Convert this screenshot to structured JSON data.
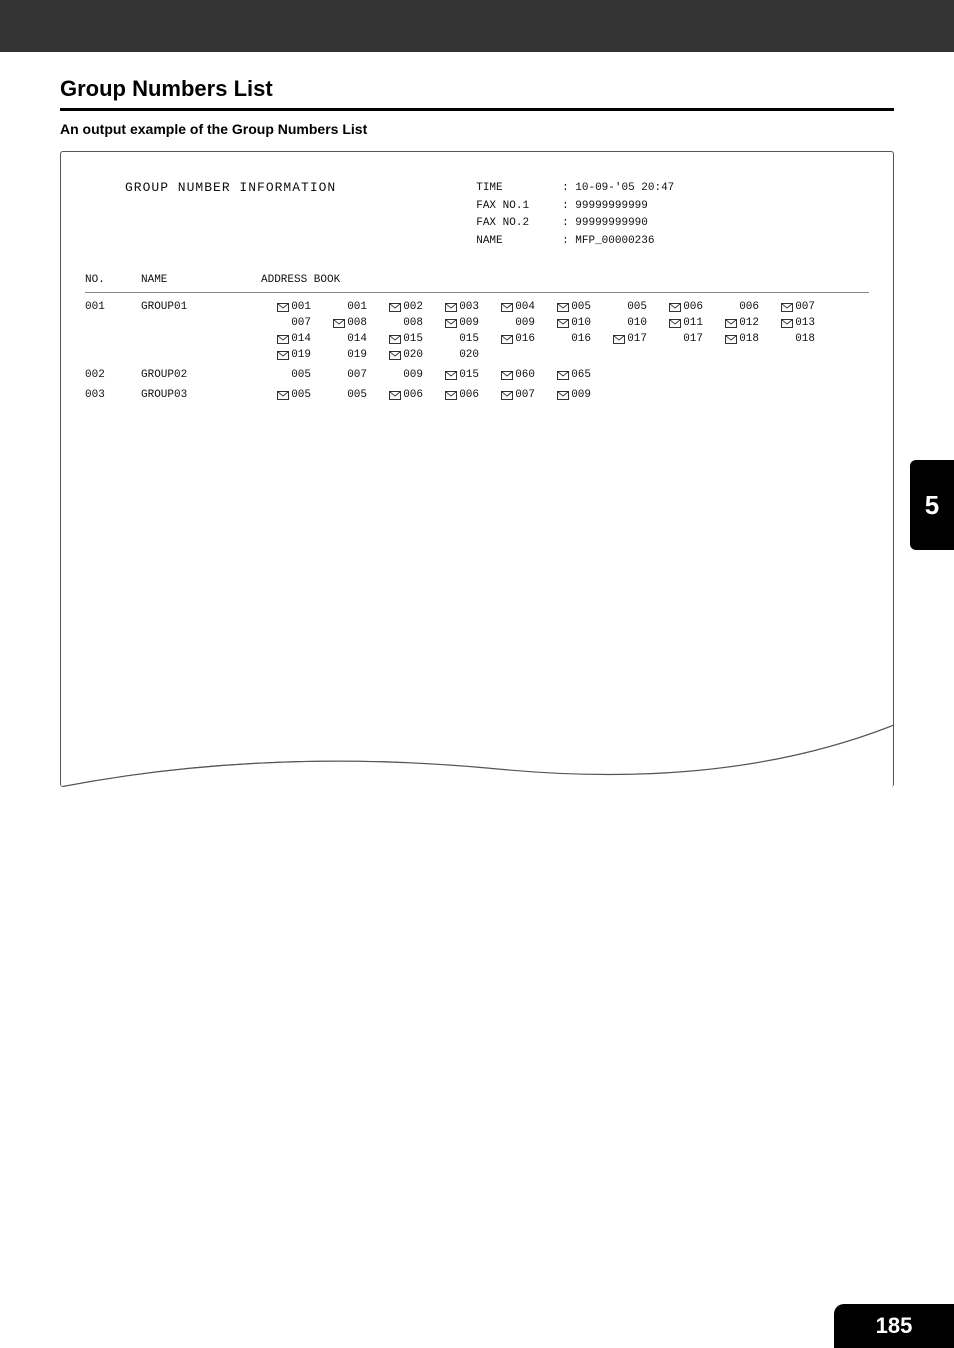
{
  "page": {
    "title": "Group Numbers List",
    "subtitle": "An output example of the Group Numbers List",
    "report_title": "GROUP NUMBER INFORMATION",
    "meta": {
      "time_label": "TIME",
      "time_value": ": 10-09-'05 20:47",
      "fax1_label": "FAX NO.1",
      "fax1_value": ": 99999999999",
      "fax2_label": "FAX NO.2",
      "fax2_value": ": 99999999990",
      "name_label": "NAME",
      "name_value": ": MFP_00000236"
    },
    "columns": {
      "no": "NO.",
      "name": "NAME",
      "book": "ADDRESS BOOK"
    },
    "groups": [
      {
        "no": "001",
        "name": "GROUP01",
        "entries": [
          {
            "n": "001",
            "m": true
          },
          {
            "n": "001",
            "m": false
          },
          {
            "n": "002",
            "m": true
          },
          {
            "n": "003",
            "m": true
          },
          {
            "n": "004",
            "m": true
          },
          {
            "n": "005",
            "m": true
          },
          {
            "n": "005",
            "m": false
          },
          {
            "n": "006",
            "m": true
          },
          {
            "n": "006",
            "m": false
          },
          {
            "n": "007",
            "m": true
          },
          {
            "n": "007",
            "m": false
          },
          {
            "n": "008",
            "m": true
          },
          {
            "n": "008",
            "m": false
          },
          {
            "n": "009",
            "m": true
          },
          {
            "n": "009",
            "m": false
          },
          {
            "n": "010",
            "m": true
          },
          {
            "n": "010",
            "m": false
          },
          {
            "n": "011",
            "m": true
          },
          {
            "n": "012",
            "m": true
          },
          {
            "n": "013",
            "m": true
          },
          {
            "n": "014",
            "m": true
          },
          {
            "n": "014",
            "m": false
          },
          {
            "n": "015",
            "m": true
          },
          {
            "n": "015",
            "m": false
          },
          {
            "n": "016",
            "m": true
          },
          {
            "n": "016",
            "m": false
          },
          {
            "n": "017",
            "m": true
          },
          {
            "n": "017",
            "m": false
          },
          {
            "n": "018",
            "m": true
          },
          {
            "n": "018",
            "m": false
          },
          {
            "n": "019",
            "m": true
          },
          {
            "n": "019",
            "m": false
          },
          {
            "n": "020",
            "m": true
          },
          {
            "n": "020",
            "m": false
          }
        ]
      },
      {
        "no": "002",
        "name": "GROUP02",
        "entries": [
          {
            "n": "005",
            "m": false
          },
          {
            "n": "007",
            "m": false
          },
          {
            "n": "009",
            "m": false
          },
          {
            "n": "015",
            "m": true
          },
          {
            "n": "060",
            "m": true
          },
          {
            "n": "065",
            "m": true
          }
        ]
      },
      {
        "no": "003",
        "name": "GROUP03",
        "entries": [
          {
            "n": "005",
            "m": true
          },
          {
            "n": "005",
            "m": false
          },
          {
            "n": "006",
            "m": true
          },
          {
            "n": "006",
            "m": true
          },
          {
            "n": "007",
            "m": true
          },
          {
            "n": "009",
            "m": true
          }
        ]
      }
    ],
    "side_tab": "5",
    "page_number": "185"
  }
}
